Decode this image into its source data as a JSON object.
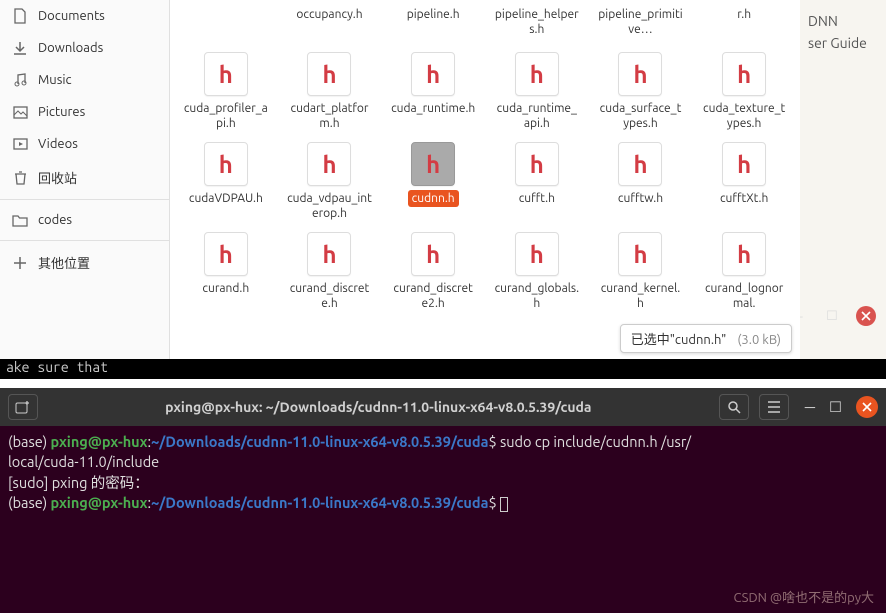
{
  "bg_doc": {
    "line1": "DNN",
    "line2": "ser Guide"
  },
  "sidebar": {
    "items": [
      {
        "label": "Documents",
        "icon": "documents-icon"
      },
      {
        "label": "Downloads",
        "icon": "downloads-icon"
      },
      {
        "label": "Music",
        "icon": "music-icon"
      },
      {
        "label": "Pictures",
        "icon": "pictures-icon"
      },
      {
        "label": "Videos",
        "icon": "videos-icon"
      },
      {
        "label": "回收站",
        "icon": "trash-icon"
      }
    ],
    "extra1": {
      "label": "codes",
      "icon": "folder-icon"
    },
    "other": {
      "label": "其他位置",
      "icon": "plus-icon"
    }
  },
  "files_row0": [
    {
      "name": "occupancy.h"
    },
    {
      "name": "pipeline.h"
    },
    {
      "name": "pipeline_helpers.h"
    },
    {
      "name": "pipeline_primitive…"
    },
    {
      "name": "r.h"
    }
  ],
  "files": [
    {
      "name": "cuda_profiler_api.h"
    },
    {
      "name": "cudart_platform.h"
    },
    {
      "name": "cuda_runtime.h"
    },
    {
      "name": "cuda_runtime_api.h"
    },
    {
      "name": "cuda_surface_types.h"
    },
    {
      "name": "cuda_texture_types.h"
    },
    {
      "name": "cudaVDPAU.h"
    },
    {
      "name": "cuda_vdpau_interop.h"
    },
    {
      "name": "cudnn.h",
      "selected": true
    },
    {
      "name": "cufft.h"
    },
    {
      "name": "cufftw.h"
    },
    {
      "name": "cufftXt.h"
    },
    {
      "name": "curand.h"
    },
    {
      "name": "curand_discrete.h"
    },
    {
      "name": "curand_discrete2.h"
    },
    {
      "name": "curand_globals.h"
    },
    {
      "name": "curand_kernel.h"
    },
    {
      "name": "curand_lognormal."
    }
  ],
  "status": {
    "text": "已选中\"cudnn.h\"",
    "size": "(3.0 kB)"
  },
  "back_line": "ake sure that",
  "terminal": {
    "title": "pxing@px-hux: ~/Downloads/cudnn-11.0-linux-x64-v8.0.5.39/cuda",
    "prompt_user": "pxing@px-hux",
    "prompt_path": "~/Downloads/cudnn-11.0-linux-x64-v8.0.5.39/cuda",
    "env": "(base)",
    "cmd1": "sudo cp include/cudnn.h /usr/",
    "cmd1_cont": "local/cuda-11.0/include",
    "sudo_line": "[sudo] pxing 的密码：",
    "watermark": "CSDN @啥也不是的py大"
  }
}
